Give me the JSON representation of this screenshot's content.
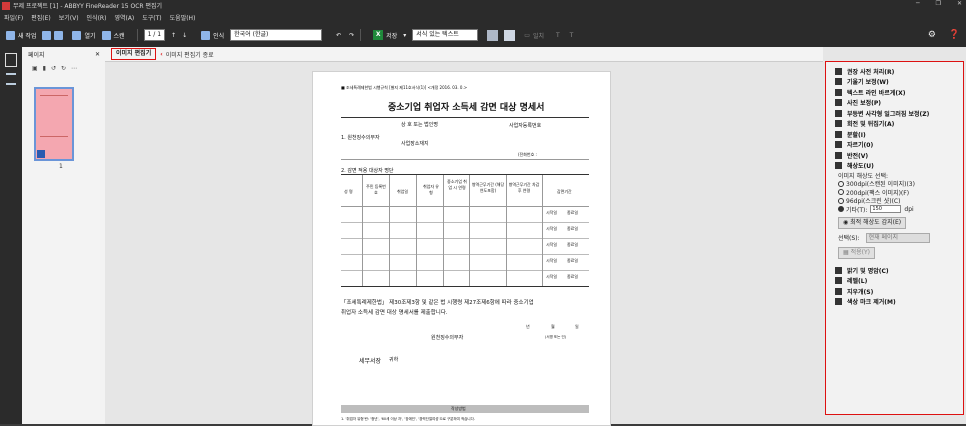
{
  "title_bar": {
    "title": "무제 프로젝트 [1] - ABBYY FineReader 15 OCR 편집기",
    "minimize": "─",
    "maximize": "❐",
    "close": "✕"
  },
  "menu": [
    "파일(F)",
    "편집(E)",
    "보기(V)",
    "인식(R)",
    "영역(A)",
    "도구(T)",
    "도움말(H)"
  ],
  "toolbar": {
    "new_task": "새 작업",
    "open": "열기",
    "scan": "스캔",
    "page_indicator": "1 / 1",
    "recognize": "인식",
    "language": "한국어 (한글)",
    "save": "저장",
    "format": "서식 있는 텍스트",
    "image_label": "일치",
    "settings_icon": "gear-icon"
  },
  "pages_pane": {
    "title": "페이지",
    "page_number": "1"
  },
  "editor_tabs": {
    "active": "이미지 편집기",
    "exit": "이미지 편집기 종료"
  },
  "document": {
    "header_note": "■ 조세특례제한법 시행규칙 [별지 제11호서식(1)] <개정 2016. 03. 0.>",
    "title": "중소기업 취업자 소득세 감면 대상 명세서",
    "sec1_label": "1. 원천징수의무자",
    "name_label": "상 호 또는 법인명",
    "bizno_label": "사업자등록번호",
    "address_label": "사업장소재지",
    "phone_label": "(전화번호 :",
    "sec2_label": "2. 감면 적용 대상자 명단",
    "col_headers": [
      "성 명",
      "주민 등록번호",
      "취업일",
      "취업자 유형",
      "중소기업 취업 시 연령",
      "병역근무기간 (해당 연도포함)",
      "병역근무기간 차감 후 연령",
      "감면기간"
    ],
    "row_tags": [
      [
        "시작일",
        "종료일"
      ],
      [
        "시작일",
        "종료일"
      ],
      [
        "시작일",
        "종료일"
      ],
      [
        "시작일",
        "종료일"
      ],
      [
        "시작일",
        "종료일"
      ]
    ],
    "statement1": "「조세특례제한법」 제30조제3항 및 같은 법 시행령 제27조제6항에 따라 중소기업",
    "statement2": "취업자 소득세 감면 대상 명세서를 제출합니다.",
    "date_year": "년",
    "date_month": "월",
    "date_day": "일",
    "withholder": "원천징수의무자",
    "sign_note": "(서명 또는 인)",
    "addressee": "세무서장",
    "honorific": "귀하",
    "guide_title": "작성방법",
    "guide_line": "1. '취업자 유형'란: '청년', '60세 이상 자', '장애인', '경력단절여성'으로 구분하여 적습니다."
  },
  "right_panel": {
    "items": [
      {
        "label": "권장 사전 처리(R)",
        "icon": "wand-icon"
      },
      {
        "label": "기울기 보정(W)",
        "icon": "deskew-icon"
      },
      {
        "label": "텍스트 라인 바르게(X)",
        "icon": "lines-icon"
      },
      {
        "label": "사진 보정(P)",
        "icon": "camera-icon"
      },
      {
        "label": "부등변 사각형 일그러짐 보정(Z)",
        "icon": "trapezoid-icon"
      },
      {
        "label": "회전 및 뒤집기(A)",
        "icon": "rotate-icon"
      },
      {
        "label": "분할(I)",
        "icon": "split-icon"
      },
      {
        "label": "자르기(0)",
        "icon": "crop-icon"
      },
      {
        "label": "반전(V)",
        "icon": "invert-icon"
      },
      {
        "label": "해상도(U)",
        "icon": "resolution-icon"
      }
    ],
    "resolution": {
      "heading": "이미지 해상도 선택:",
      "options": [
        "300dpi(스캔된 이미지)(3)",
        "200dpi(팩스 이미지)(F)",
        "96dpi(스크린 샷)(C)"
      ],
      "custom_label": "기타(T):",
      "custom_value": "150",
      "unit": "dpi",
      "best_button": "최적 해상도 감지(E)",
      "select_label": "선택(S):",
      "select_value": "현재 페이지",
      "apply": "적용(Y)"
    },
    "items_after": [
      {
        "label": "밝기 및 명암(C)",
        "icon": "brightness-icon"
      },
      {
        "label": "레벨(L)",
        "icon": "levels-icon"
      },
      {
        "label": "지우개(S)",
        "icon": "eraser-icon"
      },
      {
        "label": "색상 마크 제거(M)",
        "icon": "color-mark-icon"
      }
    ]
  }
}
